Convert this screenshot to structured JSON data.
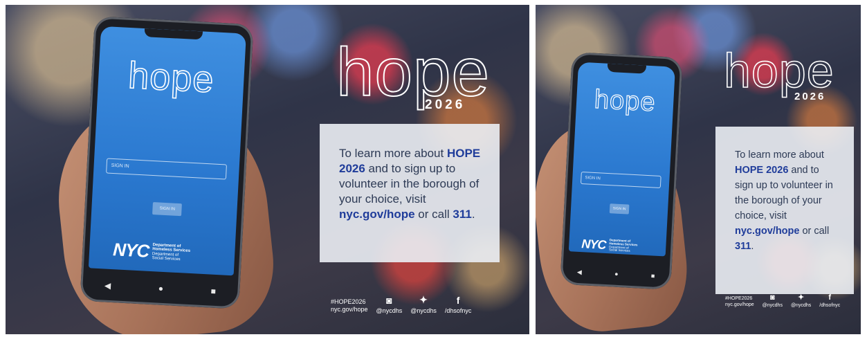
{
  "panels": [
    {
      "phone": {
        "logo": "hope",
        "signin_field": "SIGN IN",
        "signin_button": "SIGN IN",
        "agency_mark": "NYC",
        "agency_line1": "Department of",
        "agency_line2": "Homeless Services",
        "agency_line3": "Department of",
        "agency_line4": "Social Services",
        "nav_back": "◀",
        "nav_home": "●",
        "nav_recent": "■"
      },
      "title": {
        "word": "hope",
        "year": "2026"
      },
      "card": {
        "p1": "To learn more about",
        "hl1": "HOPE 2026",
        "p2": " and to sign up to volunteer in the borough of your choice, visit ",
        "hl2": "nyc.gov/hope",
        "p3": " or call ",
        "hl3": "311",
        "p4": "."
      },
      "footer": {
        "hashtag": "#HOPE2026",
        "url": "nyc.gov/hope",
        "instagram_handle": "@nycdhs",
        "twitter_handle": "@nycdhs",
        "facebook_handle": "/dhsofnyc"
      }
    },
    {
      "phone": {
        "logo": "hope",
        "signin_field": "SIGN IN",
        "signin_button": "SIGN IN",
        "agency_mark": "NYC",
        "agency_line1": "Department of",
        "agency_line2": "Homeless Services",
        "agency_line3": "Department of",
        "agency_line4": "Social Services",
        "nav_back": "◀",
        "nav_home": "●",
        "nav_recent": "■"
      },
      "title": {
        "word": "hope",
        "year": "2026"
      },
      "card": {
        "p1": "To learn more about",
        "hl1": "HOPE 2026",
        "p2": " and to sign up to volunteer in the borough of your choice, visit ",
        "hl2": "nyc.gov/hope",
        "p3": " or call ",
        "hl3": "311",
        "p4": "."
      },
      "footer": {
        "hashtag": "#HOPE2026",
        "url": "nyc.gov/hope",
        "instagram_handle": "@nycdhs",
        "twitter_handle": "@nycdhs",
        "facebook_handle": "/dhsofnyc"
      }
    }
  ],
  "icons": {
    "instagram": "instagram-icon",
    "twitter": "twitter-icon",
    "facebook": "facebook-icon"
  },
  "colors": {
    "highlight": "#1f3c9a",
    "card_text": "#2d3a55",
    "screen_blue": "#2a78cf"
  }
}
